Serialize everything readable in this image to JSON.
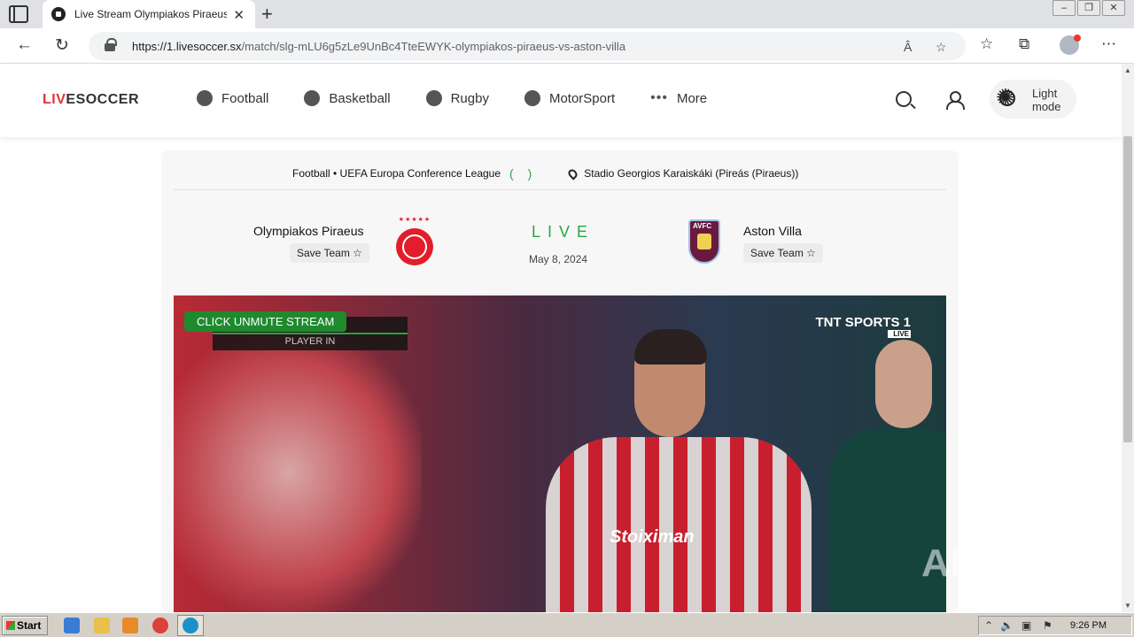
{
  "browser": {
    "tab_title": "Live Stream Olympiakos Piraeus vs Aston Villa",
    "tab_close": "✕",
    "new_tab": "+",
    "url_host": "https://1.livesoccer.sx",
    "url_path": "/match/slg-mLU6g5zLe9UnBc4TteEWYK-olympiakos-piraeus-vs-aston-villa",
    "read_aloud_label": "Â",
    "back": "←",
    "refresh": "↻",
    "menu_dots": "⋯"
  },
  "site": {
    "logo_part1": "LIV",
    "logo_part2": "ESOCCER",
    "nav": [
      {
        "label": "Football"
      },
      {
        "label": "Basketball"
      },
      {
        "label": "Rugby"
      },
      {
        "label": "MotorSport"
      },
      {
        "label": "More"
      }
    ],
    "mode_label": "Light mode"
  },
  "match": {
    "competition": "Football • UEFA Europa Conference League",
    "paren": "( )",
    "venue": "Stadio Georgios Karaiskáki (Pireás (Piraeus))",
    "home_team": "Olympiakos Piraeus",
    "away_team": "Aston Villa",
    "save_team_label": "Save Team ☆",
    "status": "LIVE",
    "date": "May 8, 2024",
    "away_crest_text": "AVFC"
  },
  "video": {
    "unmute_label": "CLICK UNMUTE STREAM",
    "scorebug_text": "PLAYER IN",
    "broadcaster": "TNT SPORTS 1",
    "broadcaster_tag": "LIVE",
    "sponsor": "Stoiximan",
    "watermark": "ANY RUN"
  },
  "taskbar": {
    "start_label": "Start",
    "time": "9:26 PM"
  }
}
